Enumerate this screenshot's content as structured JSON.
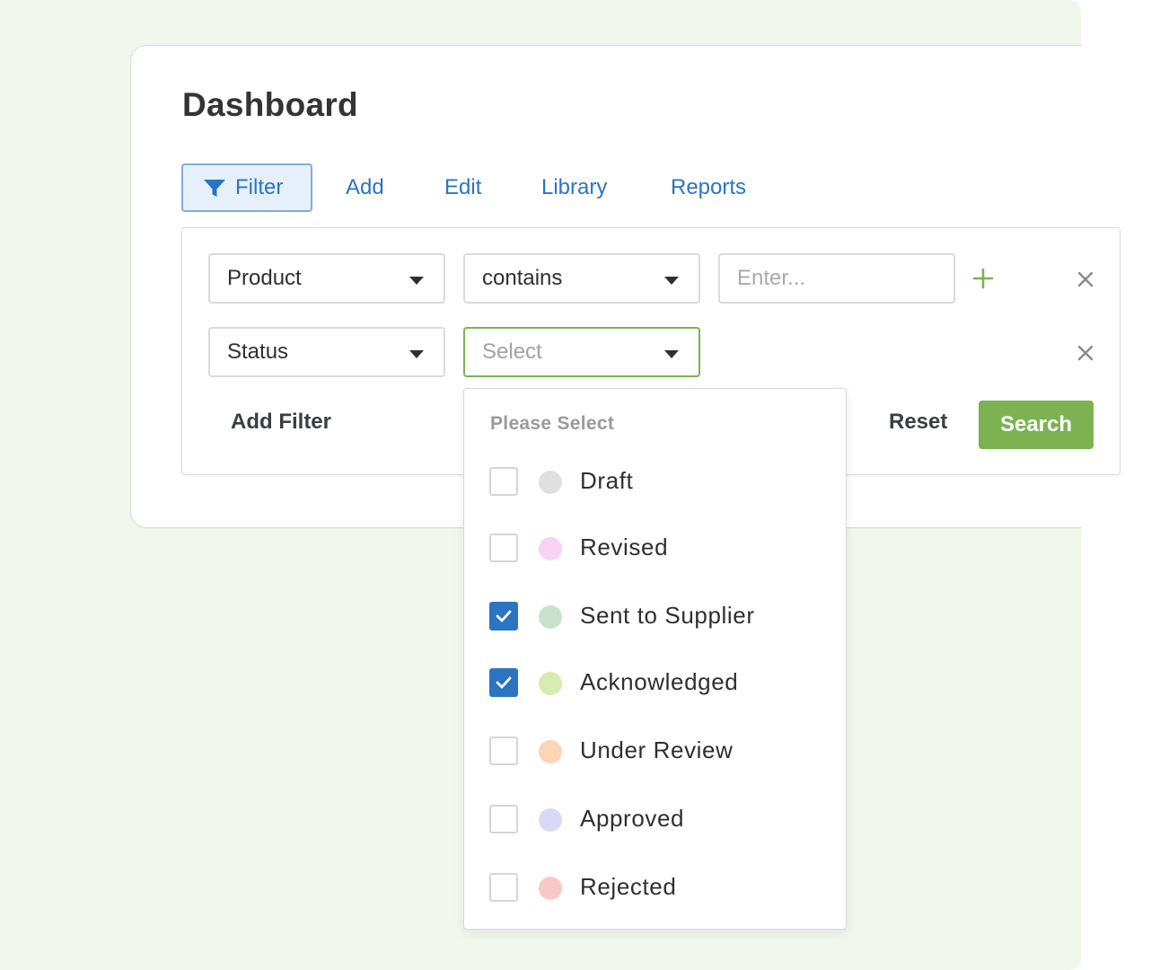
{
  "page": {
    "title": "Dashboard"
  },
  "tabs": [
    {
      "label": "Filter",
      "active": true,
      "icon": "funnel-icon"
    },
    {
      "label": "Add"
    },
    {
      "label": "Edit"
    },
    {
      "label": "Library"
    },
    {
      "label": "Reports"
    }
  ],
  "filters": {
    "row1": {
      "field": "Product",
      "operator": "contains",
      "value_placeholder": "Enter...",
      "add_icon": "plus-icon",
      "remove_icon": "close-icon"
    },
    "row2": {
      "field": "Status",
      "value_placeholder": "Select",
      "remove_icon": "close-icon"
    },
    "add_filter_label": "Add Filter",
    "reset_label": "Reset",
    "search_label": "Search"
  },
  "status_dropdown": {
    "header": "Please Select",
    "options": [
      {
        "label": "Draft",
        "checked": false,
        "color": "#e0e0e0"
      },
      {
        "label": "Revised",
        "checked": false,
        "color": "#f6d3f7"
      },
      {
        "label": "Sent to Supplier",
        "checked": true,
        "color": "#c9e2cd"
      },
      {
        "label": "Acknowledged",
        "checked": true,
        "color": "#d7ecaf"
      },
      {
        "label": "Under Review",
        "checked": false,
        "color": "#fbd5b5"
      },
      {
        "label": "Approved",
        "checked": false,
        "color": "#dad8f7"
      },
      {
        "label": "Rejected",
        "checked": false,
        "color": "#fbc8c8"
      }
    ]
  },
  "colors": {
    "background": "#f2f7ed",
    "accent_blue": "#2b74c1",
    "accent_green": "#7cb350",
    "tab_active_bg": "#e6f0fb"
  }
}
